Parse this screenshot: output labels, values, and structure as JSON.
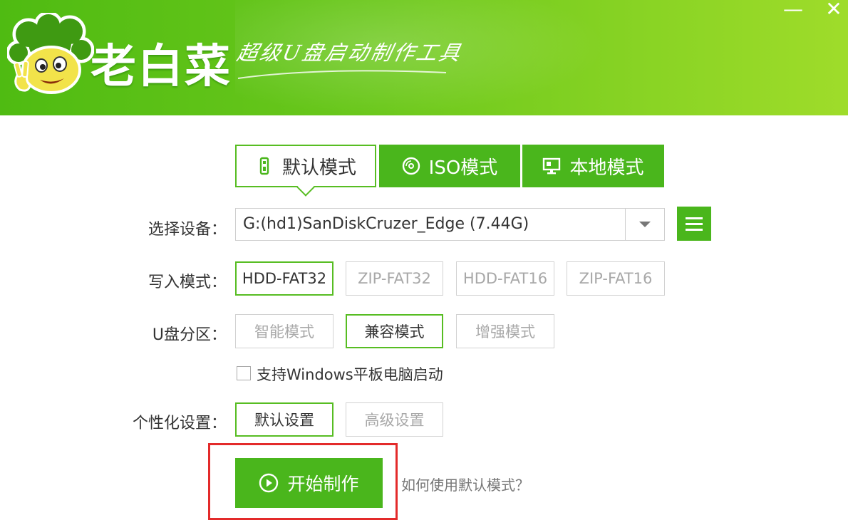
{
  "header": {
    "app_name": "老白菜",
    "tagline": "超级U盘启动制作工具",
    "minimize_glyph": "—",
    "close_glyph": "✕"
  },
  "mode_tabs": [
    {
      "label": "默认模式",
      "icon": "usb-drive-icon",
      "selected": true
    },
    {
      "label": "ISO模式",
      "icon": "disc-icon",
      "selected": false
    },
    {
      "label": "本地模式",
      "icon": "monitor-icon",
      "selected": false
    }
  ],
  "device": {
    "label": "选择设备：",
    "value": "G:(hd1)SanDiskCruzer_Edge (7.44G)"
  },
  "write_mode": {
    "label": "写入模式：",
    "options": [
      "HDD-FAT32",
      "ZIP-FAT32",
      "HDD-FAT16",
      "ZIP-FAT16"
    ],
    "selected": "HDD-FAT32"
  },
  "partition": {
    "label": "U盘分区：",
    "options": [
      "智能模式",
      "兼容模式",
      "增强模式"
    ],
    "selected": "兼容模式"
  },
  "tablet_boot": {
    "label": "支持Windows平板电脑启动",
    "checked": false
  },
  "personalize": {
    "label": "个性化设置：",
    "options": [
      "默认设置",
      "高级设置"
    ],
    "selected": "默认设置"
  },
  "actions": {
    "start_label": "开始制作",
    "help_link": "如何使用默认模式？"
  },
  "colors": {
    "brand_green": "#4ab61c",
    "highlight_red": "#e32a2a"
  }
}
